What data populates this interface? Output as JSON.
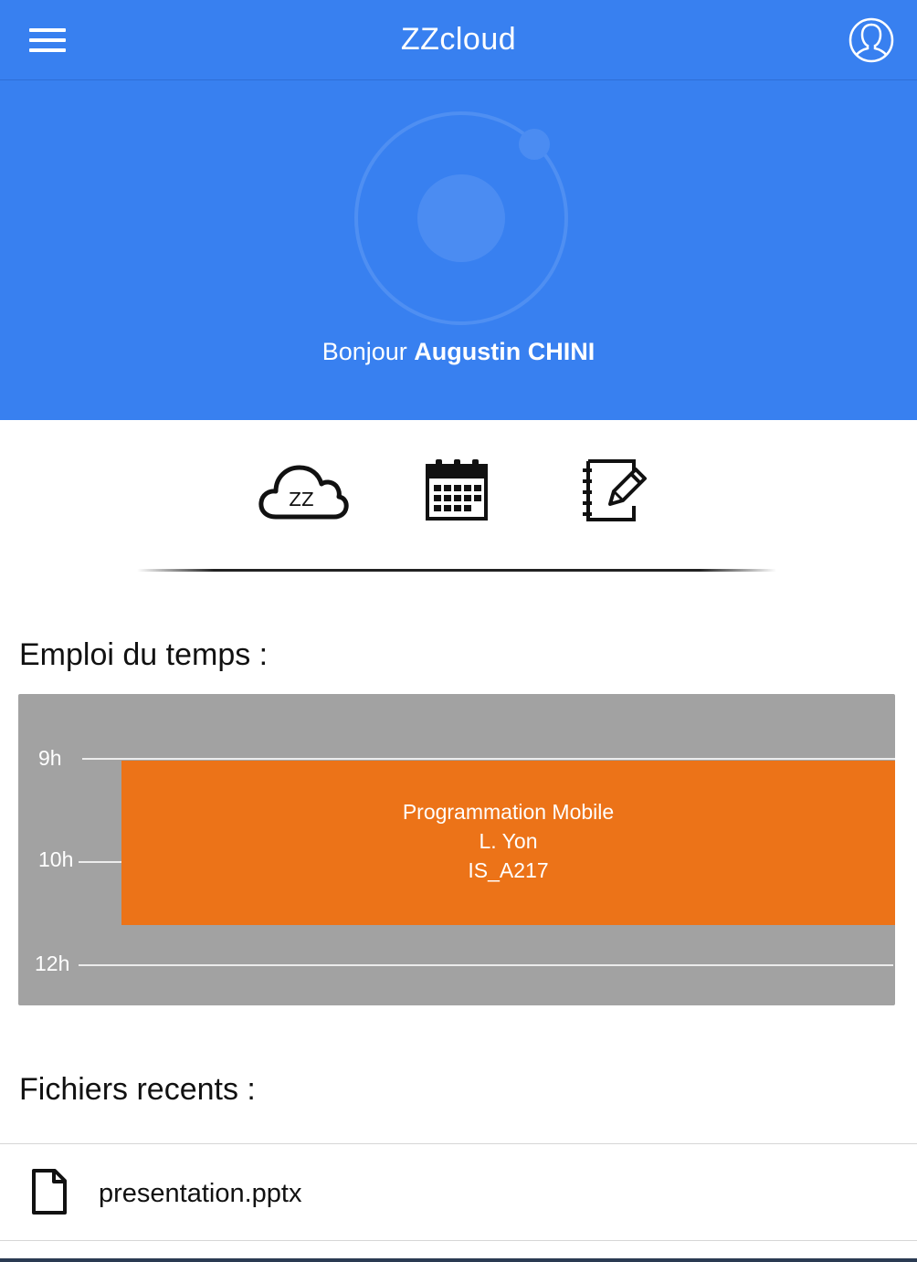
{
  "header": {
    "title": "ZZcloud",
    "menu_icon": "hamburger-menu-icon",
    "profile_icon": "user-profile-icon",
    "color": "#3880f0"
  },
  "hero": {
    "logo_icon": "ionic-logo-icon",
    "greeting_prefix": "Bonjour ",
    "user_name": "Augustin CHINI"
  },
  "quick_actions": [
    {
      "icon": "zz-cloud-icon",
      "label": "ZZ"
    },
    {
      "icon": "calendar-icon"
    },
    {
      "icon": "notes-edit-icon"
    }
  ],
  "schedule": {
    "title": "Emploi du temps :",
    "hours": [
      "9h",
      "10h",
      "12h"
    ],
    "event": {
      "course": "Programmation Mobile",
      "teacher": "L. Yon",
      "room": "IS_A217",
      "color": "#ec7318"
    }
  },
  "files": {
    "title": "Fichiers recents :",
    "items": [
      {
        "name": "presentation.pptx",
        "icon": "file-icon"
      }
    ]
  }
}
